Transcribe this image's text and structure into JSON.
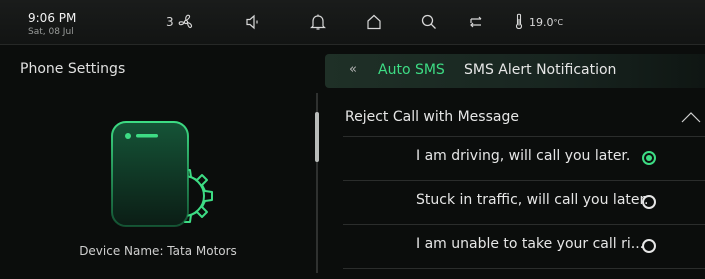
{
  "status_bar": {
    "time": "9:06 PM",
    "date": "Sat, 08 Jul",
    "fan_speed": "3",
    "temperature": "19.0",
    "temperature_unit": "°C",
    "icons": [
      "fan-icon",
      "volume-icon",
      "bell-icon",
      "home-icon",
      "search-icon",
      "media-source-icon",
      "thermometer-icon"
    ]
  },
  "left_panel": {
    "title": "Phone Settings",
    "device_name": "Device Name: Tata Motors"
  },
  "tabs": {
    "back_icon": "«",
    "active": "Auto SMS",
    "other": "SMS Alert Notification"
  },
  "section": {
    "label": "Reject Call with Message",
    "expanded": true
  },
  "options": [
    {
      "text": "I am driving, will call you later.",
      "selected": true
    },
    {
      "text": "Stuck in traffic, will call you later.",
      "selected": false
    },
    {
      "text": "I am unable to take your call ri...",
      "selected": false
    }
  ],
  "colors": {
    "accent": "#3ddc84",
    "background": "#0b0d0c",
    "tab_bar": "#1f3027"
  }
}
